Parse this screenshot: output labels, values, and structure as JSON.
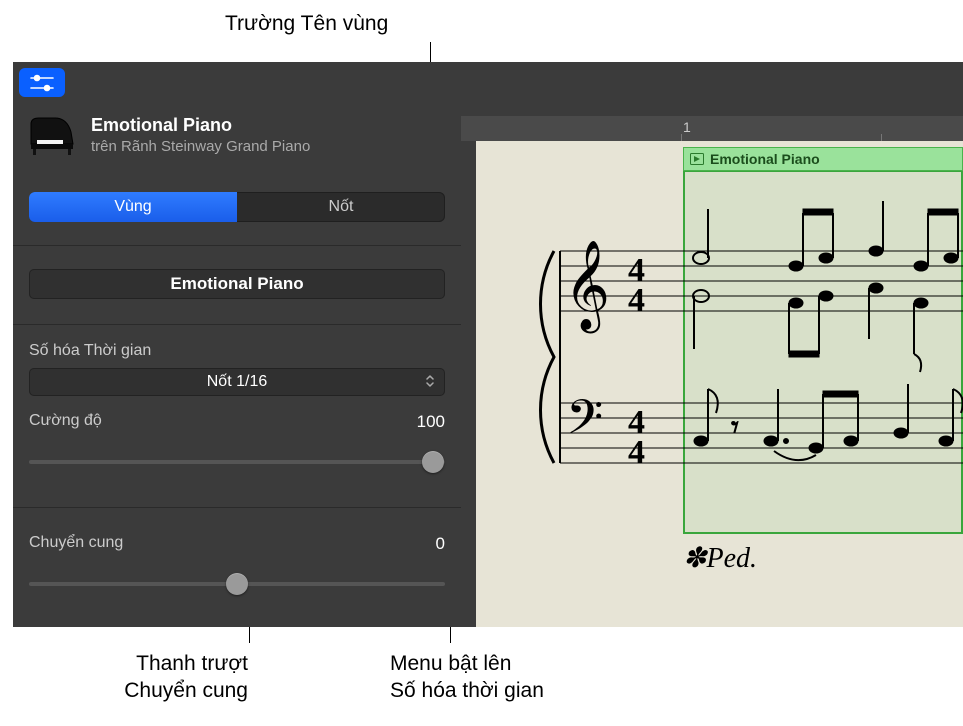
{
  "callouts": {
    "region_name": "Trường Tên vùng",
    "transpose_slider": "Thanh trượt\nChuyển cung",
    "time_quantize_menu": "Menu bật lên\nSố hóa thời gian"
  },
  "inspector": {
    "region_title": "Emotional Piano",
    "region_subtitle": "trên Rãnh Steinway Grand Piano",
    "tabs": {
      "region": "Vùng",
      "note": "Nốt"
    },
    "name_field": "Emotional Piano",
    "time_quantize": {
      "label": "Số hóa Thời gian",
      "value": "Nốt 1/16"
    },
    "velocity": {
      "label": "Cường độ",
      "value": "100"
    },
    "transpose": {
      "label": "Chuyển cung",
      "value": "0"
    }
  },
  "score": {
    "ruler_marker": "1",
    "region_name": "Emotional Piano",
    "pedal": "✽Ped."
  }
}
